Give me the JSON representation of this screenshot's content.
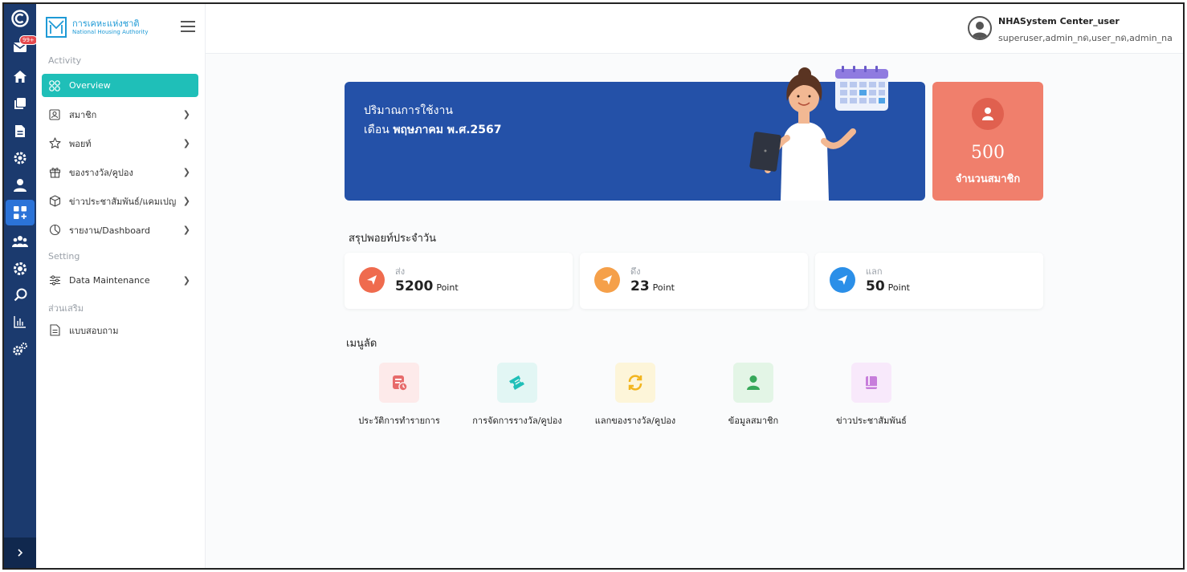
{
  "rail": {
    "badge": "99+",
    "items": [
      "logo-icon",
      "mail-icon",
      "home-icon",
      "copy-icon",
      "document-icon",
      "settings-icon",
      "user-icon",
      "dashboard-icon",
      "team-icon",
      "gear-badge-icon",
      "search-icon",
      "chart-icon",
      "cogs-icon"
    ],
    "expand_icon": "chevron-right-icon"
  },
  "brand": {
    "name_th": "การเคหะแห่งชาติ",
    "name_en": "National Housing Authority"
  },
  "sidebar": {
    "section_activity": "Activity",
    "section_setting": "Setting",
    "section_extra": "ส่วนเสริม",
    "items": [
      {
        "label": "Overview",
        "icon": "grid-icon",
        "active": true
      },
      {
        "label": "สมาชิก",
        "icon": "id-card-icon"
      },
      {
        "label": "พอยท์",
        "icon": "star-icon"
      },
      {
        "label": "ของรางวัล/คูปอง",
        "icon": "gift-icon"
      },
      {
        "label": "ข่าวประชาสัมพันธ์/แคมเปญ",
        "icon": "box-icon"
      },
      {
        "label": "รายงาน/Dashboard",
        "icon": "pie-icon"
      },
      {
        "label": "Data Maintenance",
        "icon": "sliders-icon"
      },
      {
        "label": "แบบสอบถาม",
        "icon": "form-icon"
      }
    ]
  },
  "user": {
    "name": "NHASystem Center_user",
    "roles": "superuser,admin_nด,user_nด,admin_na"
  },
  "hero": {
    "line1": "ปริมาณการใช้งาน",
    "line2_prefix": "เดือน ",
    "line2_bold": "พฤษภาคม พ.ศ.2567"
  },
  "members": {
    "count": "500",
    "label": "จำนวนสมาชิก"
  },
  "points": {
    "title": "สรุปพอยท์ประจำวัน",
    "cards": [
      {
        "label": "ส่ง",
        "value": "5200",
        "unit": "Point",
        "color": "#ef6b4e"
      },
      {
        "label": "ดึง",
        "value": "23",
        "unit": "Point",
        "color": "#f5a04a"
      },
      {
        "label": "แลก",
        "value": "50",
        "unit": "Point",
        "color": "#2b8fe8"
      }
    ]
  },
  "shortcuts": {
    "title": "เมนูลัด",
    "items": [
      {
        "label": "ประวัติการทำรายการ",
        "bg": "#fdeaea",
        "fg": "#e76b6b",
        "icon": "history-icon"
      },
      {
        "label": "การจัดการรางวัล/คูปอง",
        "bg": "#e2f6f4",
        "fg": "#1fbfb8",
        "icon": "ticket-icon"
      },
      {
        "label": "แลกของรางวัล/คูปอง",
        "bg": "#fdf5d9",
        "fg": "#f2b51f",
        "icon": "exchange-icon"
      },
      {
        "label": "ข้อมูลสมาชิก",
        "bg": "#e3f5e6",
        "fg": "#37a85a",
        "icon": "member-icon"
      },
      {
        "label": "ข่าวประชาสัมพันธ์",
        "bg": "#f8e9fb",
        "fg": "#c77ddb",
        "icon": "book-icon"
      }
    ]
  }
}
